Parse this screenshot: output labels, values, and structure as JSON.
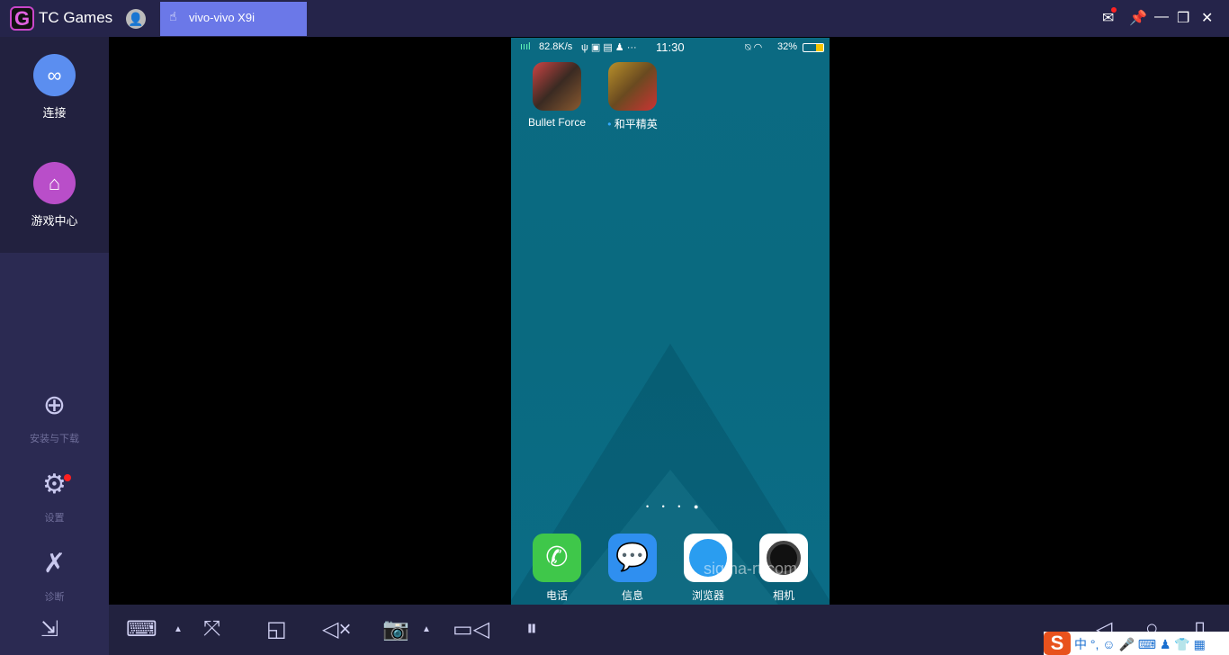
{
  "titlebar": {
    "app_name": "TC Games",
    "logo_letter": "G",
    "device_tab": "vivo-vivo X9i",
    "icons": [
      "user-icon",
      "mail-icon",
      "pin-icon",
      "minimize-icon",
      "restore-icon",
      "close-icon"
    ]
  },
  "sidebar": {
    "items": [
      {
        "label": "连接",
        "icon": "link-icon",
        "color": "#5b8ef0"
      },
      {
        "label": "游戏中心",
        "icon": "home-icon",
        "color": "#b94ec9"
      },
      {
        "label": "安装与下载",
        "icon": "download-icon"
      },
      {
        "label": "设置",
        "icon": "gear-icon",
        "badge_color": "#ff2020"
      },
      {
        "label": "诊断",
        "icon": "tools-icon"
      }
    ]
  },
  "phone": {
    "status": {
      "speed": "82.8K/s",
      "time": "11:30",
      "battery": "32%"
    },
    "apps": [
      {
        "label": "Bullet Force"
      },
      {
        "label": "和平精英"
      }
    ],
    "dock": [
      {
        "label": "电话"
      },
      {
        "label": "信息"
      },
      {
        "label": "浏览器"
      },
      {
        "label": "相机"
      }
    ],
    "page_dots": "• • • ●",
    "watermark": "sigma-rt.com"
  },
  "toolbar": {
    "icons": [
      "collapse-icon",
      "keyboard-icon",
      "caret-up-icon",
      "fullscreen-icon",
      "window-icon",
      "mute-icon",
      "camera-icon",
      "caret-up-icon",
      "record-icon",
      "pause-icon",
      "back-icon",
      "home-icon",
      "recents-icon"
    ]
  },
  "ime_tray": {
    "logo": "S",
    "lang": "中",
    "punct": "°,"
  }
}
